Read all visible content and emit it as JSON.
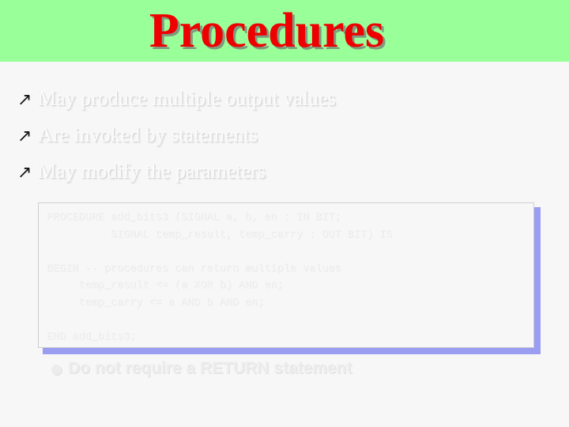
{
  "slide": {
    "title": "Procedures",
    "banner_color": "#99ff99",
    "title_color": "#ee0000",
    "background_color": "#f7f7f7"
  },
  "bullets": [
    {
      "marker": "↗",
      "text": "May produce multiple output values"
    },
    {
      "marker": "↗",
      "text": "Are invoked by statements"
    },
    {
      "marker": "↗",
      "text": "May modify the parameters"
    }
  ],
  "code_box": {
    "shadow_color": "#8b8df0",
    "code": "PROCEDURE add_bits3 (SIGNAL a, b, en : IN BIT;\n          SIGNAL temp_result, temp_carry : OUT BIT) IS\n\nBEGIN -- procedures can return multiple values\n     temp_result <= (a XOR b) AND en;\n     temp_carry <= a AND b AND en;\n\nEND add_bits3;"
  },
  "sub_bullet": {
    "marker": "●",
    "text": "Do not require a RETURN statement"
  }
}
